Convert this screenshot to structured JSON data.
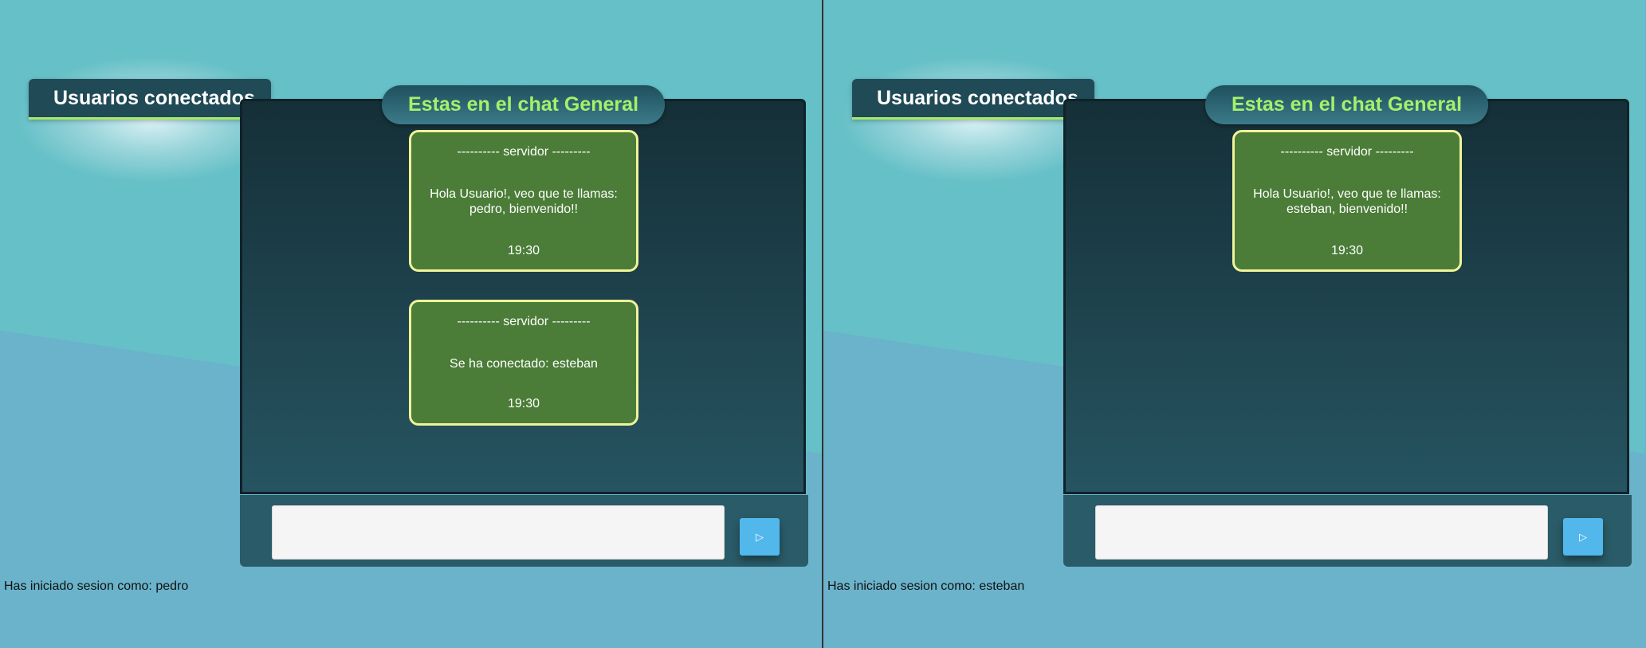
{
  "colors": {
    "title_text": "#a6f06b",
    "bubble_bg": "#4b7d38",
    "bubble_border": "#f0f39a",
    "send_button": "#52b7eb",
    "accent_underline": "#a6e86a"
  },
  "panes": [
    {
      "users_panel_title": "Usuarios conectados",
      "chat_title": "Estas en el chat General",
      "messages": [
        {
          "sender": "---------- servidor ---------",
          "text": "Hola Usuario!, veo que te llamas: pedro, bienvenido!!",
          "time": "19:30"
        },
        {
          "sender": "---------- servidor ---------",
          "text": "Se ha conectado: esteban",
          "time": "19:30"
        }
      ],
      "input": {
        "value": "",
        "placeholder": ""
      },
      "send_icon": "▷",
      "send_icon_name": "play-triangle-icon",
      "session_text": "Has iniciado sesion como: pedro"
    },
    {
      "users_panel_title": "Usuarios conectados",
      "chat_title": "Estas en el chat General",
      "messages": [
        {
          "sender": "---------- servidor ---------",
          "text": "Hola Usuario!, veo que te llamas: esteban, bienvenido!!",
          "time": "19:30"
        }
      ],
      "input": {
        "value": "",
        "placeholder": ""
      },
      "send_icon": "▷",
      "send_icon_name": "play-triangle-icon",
      "session_text": "Has iniciado sesion como: esteban"
    }
  ]
}
